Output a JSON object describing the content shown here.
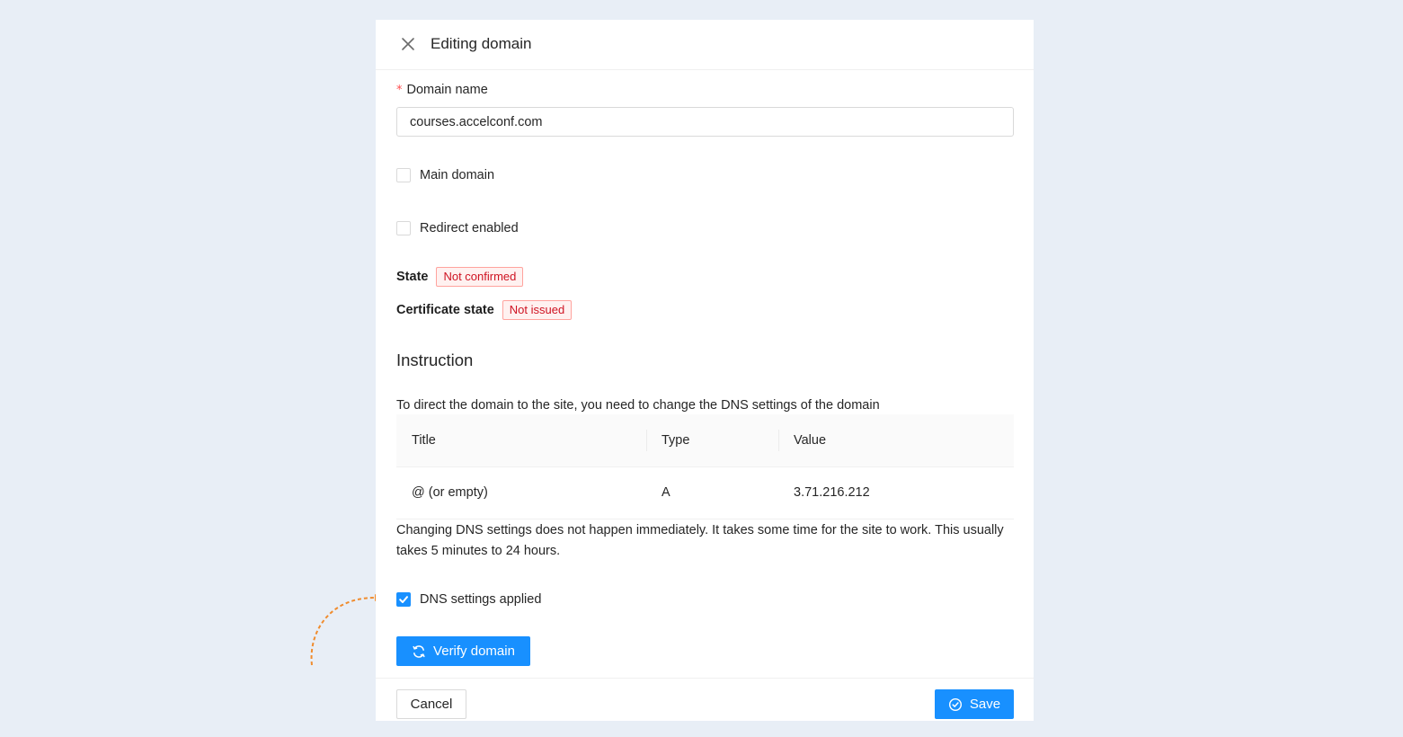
{
  "drawer": {
    "title": "Editing domain",
    "close_icon": "close-icon"
  },
  "form": {
    "domain_name": {
      "required_mark": "*",
      "label": "Domain name",
      "value": "courses.accelconf.com"
    },
    "main_domain": {
      "label": "Main domain",
      "checked": false
    },
    "redirect_enabled": {
      "label": "Redirect enabled",
      "checked": false
    },
    "state": {
      "label": "State",
      "value": "Not confirmed"
    },
    "certificate_state": {
      "label": "Certificate state",
      "value": "Not issued"
    }
  },
  "instruction": {
    "title": "Instruction",
    "text": "To direct the domain to the site, you need to change the DNS settings of the domain",
    "table": {
      "columns": [
        "Title",
        "Type",
        "Value"
      ],
      "rows": [
        [
          "@ (or empty)",
          "A",
          "3.71.216.212"
        ]
      ]
    },
    "note": "Changing DNS settings does not happen immediately. It takes some time for the site to work. This usually takes 5 minutes to 24 hours."
  },
  "dns_applied": {
    "label": "DNS settings applied",
    "checked": true
  },
  "verify_button": {
    "label": "Verify domain",
    "icon": "sync-icon"
  },
  "footer": {
    "cancel_label": "Cancel",
    "save_label": "Save",
    "save_icon": "check-circle-icon"
  },
  "colors": {
    "primary": "#1890ff",
    "tag_error_text": "#cf1322",
    "tag_error_bg": "#fff1f0",
    "tag_error_border": "#ffa39e",
    "annotation": "#f08c2e",
    "page_background": "#e8eef6"
  }
}
